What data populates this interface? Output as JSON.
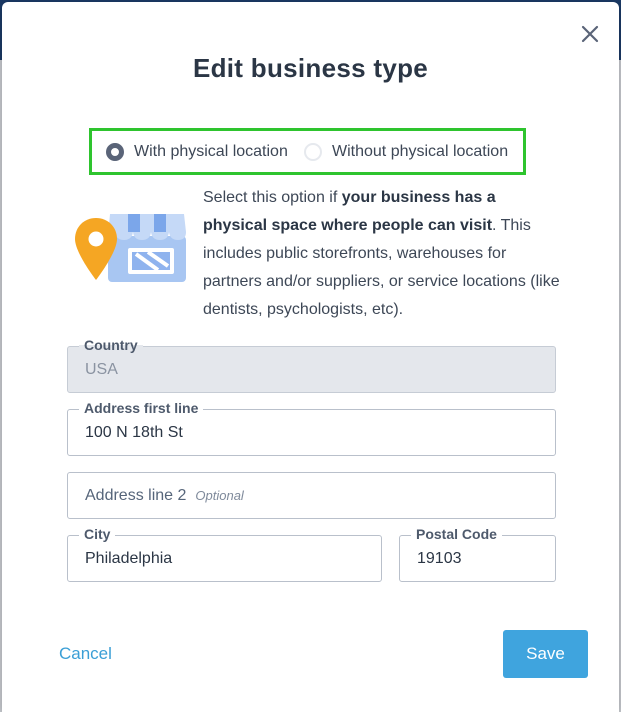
{
  "modal": {
    "title": "Edit business type",
    "close_icon": "close-icon"
  },
  "business_type": {
    "options": [
      {
        "label": "With physical location",
        "checked": true
      },
      {
        "label": "Without physical location",
        "checked": false
      }
    ],
    "highlight_color": "#2ec42e"
  },
  "description": {
    "text_before": "Select this option if ",
    "bold": "your business has a physical space where people can visit",
    "text_after": ". This includes public storefronts, warehouses for partners and/or suppliers, or service locations (like dentists, psychologists, etc).",
    "illustration_icon": "storefront-with-location-pin-icon"
  },
  "form": {
    "country": {
      "label": "Country",
      "value": "USA",
      "disabled": true
    },
    "address1": {
      "label": "Address first line",
      "value": "100 N 18th St"
    },
    "address2": {
      "placeholder": "Address line 2",
      "optional": "Optional"
    },
    "city": {
      "label": "City",
      "value": "Philadelphia"
    },
    "postal": {
      "label": "Postal Code",
      "value": "19103"
    }
  },
  "actions": {
    "cancel": "Cancel",
    "save": "Save",
    "accent_color": "#3fa4de"
  }
}
